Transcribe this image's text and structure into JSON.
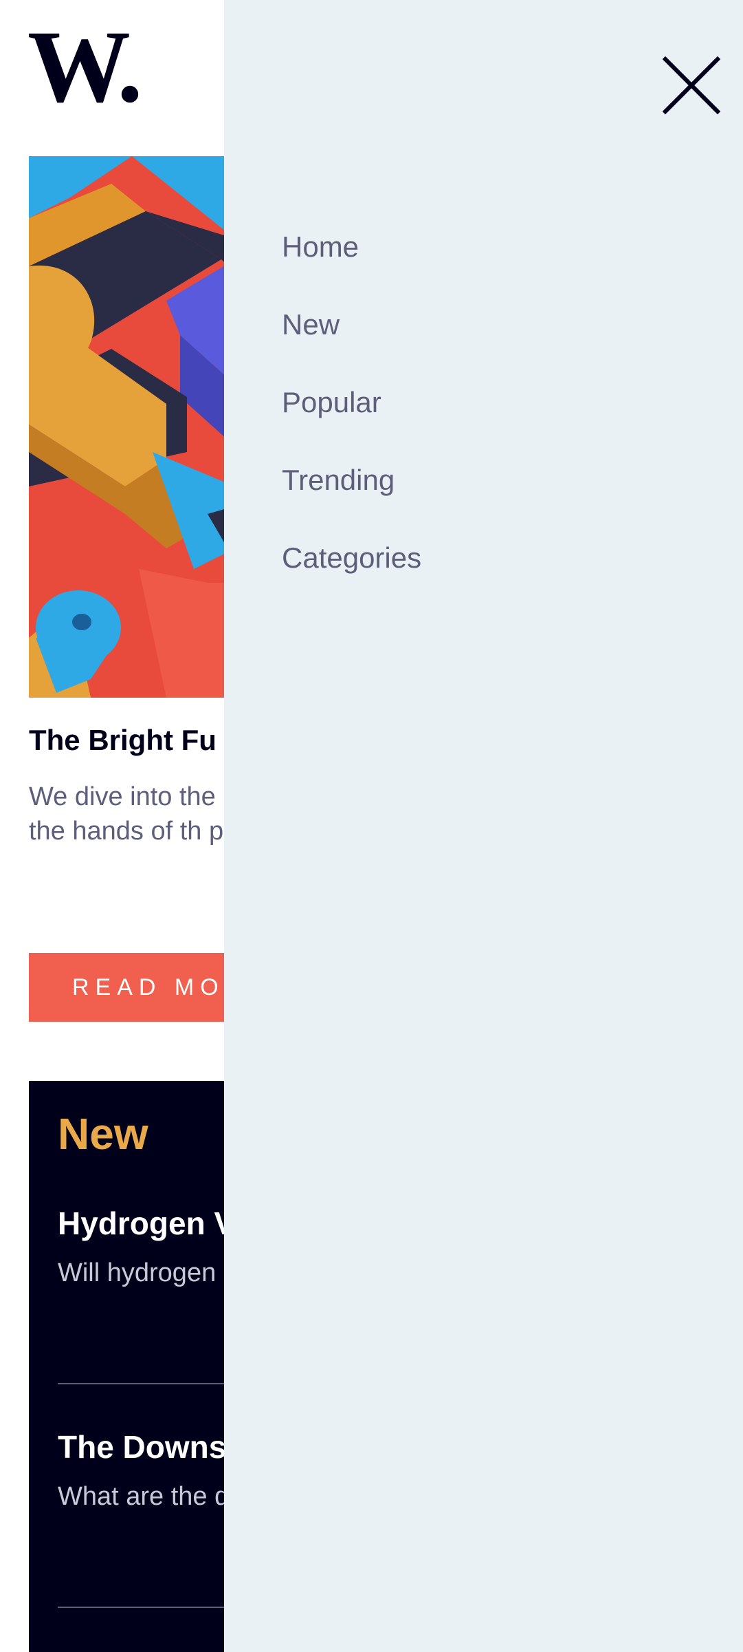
{
  "logo": {
    "text": "W."
  },
  "hero": {
    "alt": "colorful 3D block shapes illustration"
  },
  "article": {
    "title": "The Bright Fu",
    "description": "We dive into the claims to put th the hands of th promise?",
    "cta_label": "READ MOR"
  },
  "new_section": {
    "heading": "New",
    "items": [
      {
        "title": "Hydrogen V",
        "description": "Will hydrogen EVs?"
      },
      {
        "title": "The Downs",
        "description": "What are the demand AI in"
      }
    ]
  },
  "menu": {
    "close_icon": "close-icon",
    "items": [
      {
        "label": "Home"
      },
      {
        "label": "New"
      },
      {
        "label": "Popular"
      },
      {
        "label": "Trending"
      },
      {
        "label": "Categories"
      }
    ]
  },
  "colors": {
    "brand_dark": "#00001a",
    "accent_orange": "#e9a84a",
    "cta_red": "#f15f4f",
    "menu_bg": "#eaf1f5",
    "muted_text": "#5d5f7a"
  }
}
